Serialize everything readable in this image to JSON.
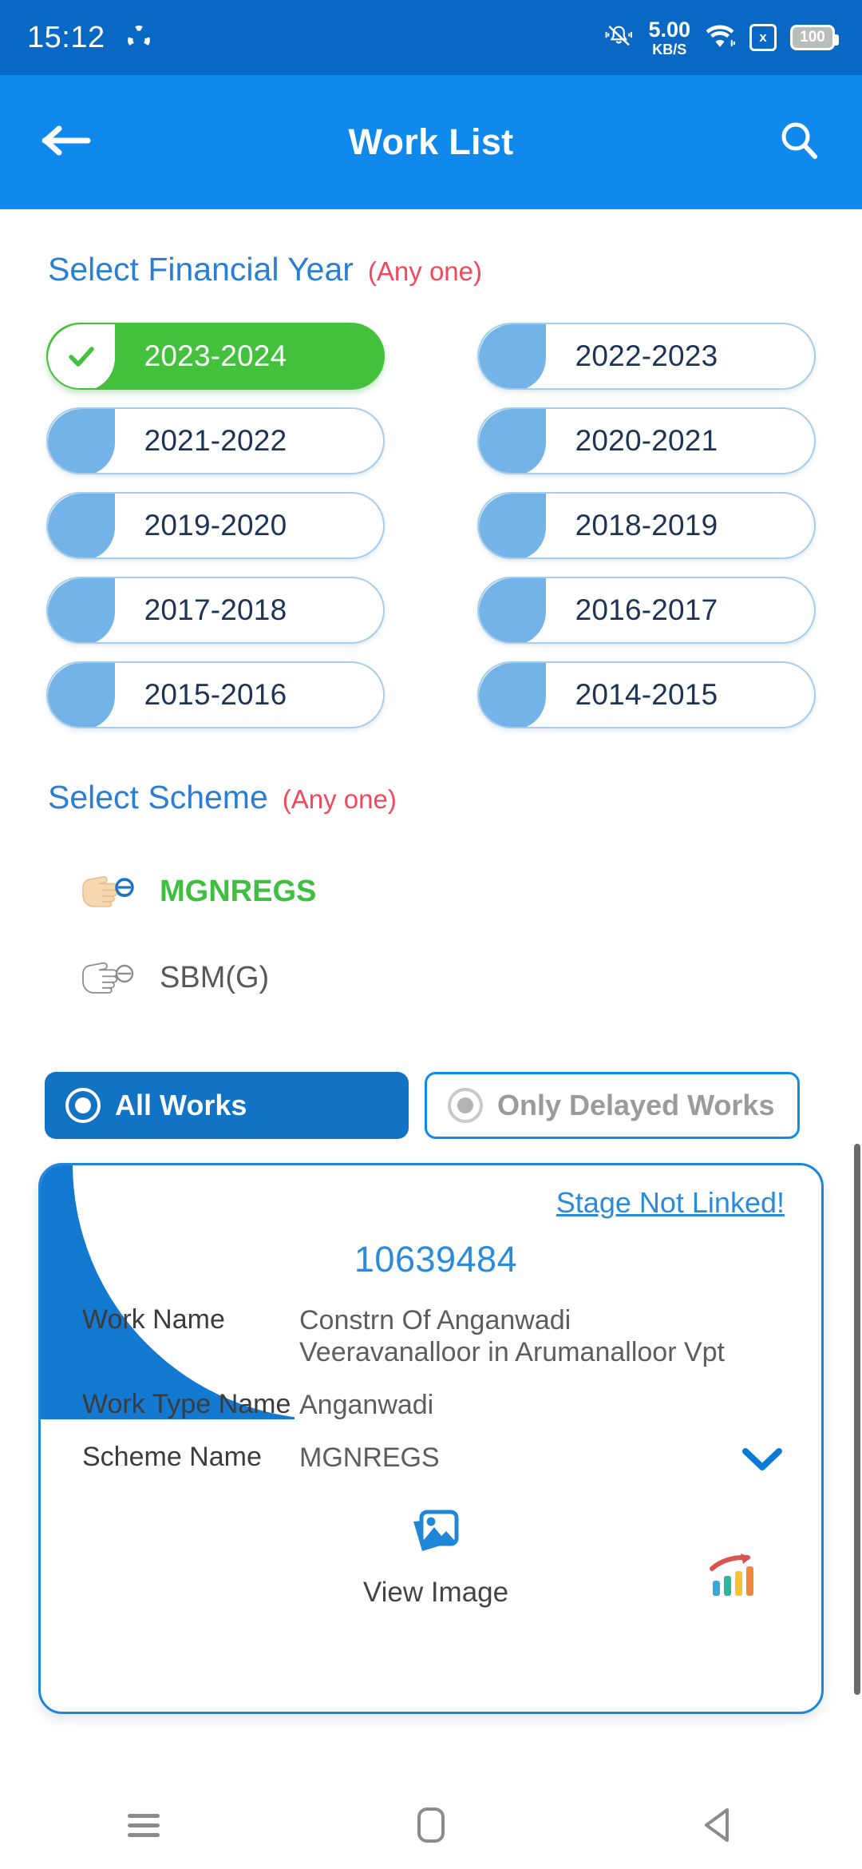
{
  "statusbar": {
    "time": "15:12",
    "app_icon": "share-icon",
    "mute_icon": "bell-muted-icon",
    "net_speed_value": "5.00",
    "net_speed_unit": "KB/S",
    "wifi_icon": "wifi-icon",
    "sim_icon": "sim-card-x-icon",
    "sim_label": "x",
    "battery_level": "100"
  },
  "appbar": {
    "back_icon": "arrow-left-icon",
    "title": "Work List",
    "search_icon": "search-icon"
  },
  "financial_year": {
    "label": "Select Financial Year",
    "note": "(Any one)",
    "options": [
      {
        "label": "2023-2024",
        "selected": true
      },
      {
        "label": "2022-2023",
        "selected": false
      },
      {
        "label": "2021-2022",
        "selected": false
      },
      {
        "label": "2020-2021",
        "selected": false
      },
      {
        "label": "2019-2020",
        "selected": false
      },
      {
        "label": "2018-2019",
        "selected": false
      },
      {
        "label": "2017-2018",
        "selected": false
      },
      {
        "label": "2016-2017",
        "selected": false
      },
      {
        "label": "2015-2016",
        "selected": false
      },
      {
        "label": "2014-2015",
        "selected": false
      }
    ],
    "check_icon": "check-icon"
  },
  "scheme": {
    "label": "Select Scheme",
    "note": "(Any one)",
    "options": [
      {
        "label": "MGNREGS",
        "selected": true,
        "icon": "pointing-hand-filled-icon"
      },
      {
        "label": "SBM(G)",
        "selected": false,
        "icon": "pointing-hand-outline-icon"
      }
    ]
  },
  "work_filter": {
    "all_works": {
      "label": "All Works",
      "selected": true,
      "icon": "radio-selected-icon"
    },
    "delayed_works": {
      "label": "Only Delayed Works",
      "selected": false,
      "icon": "radio-unselected-icon"
    }
  },
  "work_card": {
    "stage_link": "Stage Not Linked!",
    "work_id": "10639484",
    "fields": [
      {
        "key": "Work Name",
        "value": "Constrn Of Anganwadi Veeravanalloor in  Arumanalloor Vpt"
      },
      {
        "key": "Work Type Name",
        "value": "Anganwadi"
      },
      {
        "key": "Scheme Name",
        "value": "MGNREGS"
      }
    ],
    "expand_icon": "chevron-down-icon",
    "view_image": {
      "label": "View Image",
      "icon": "image-gallery-icon"
    },
    "chart_icon": "bar-chart-growth-icon"
  },
  "navbar": {
    "recents_icon": "menu-lines-icon",
    "home_icon": "home-square-icon",
    "back_icon": "back-triangle-icon"
  },
  "colors": {
    "status_bar": "#0868c4",
    "app_bar": "#1089ed",
    "accent_blue": "#2a8bdc",
    "selected_green": "#44c13c",
    "note_red": "#ef4a5c",
    "chip_leaf_blue": "#74b3e8",
    "toggle_blue": "#1272c4"
  }
}
